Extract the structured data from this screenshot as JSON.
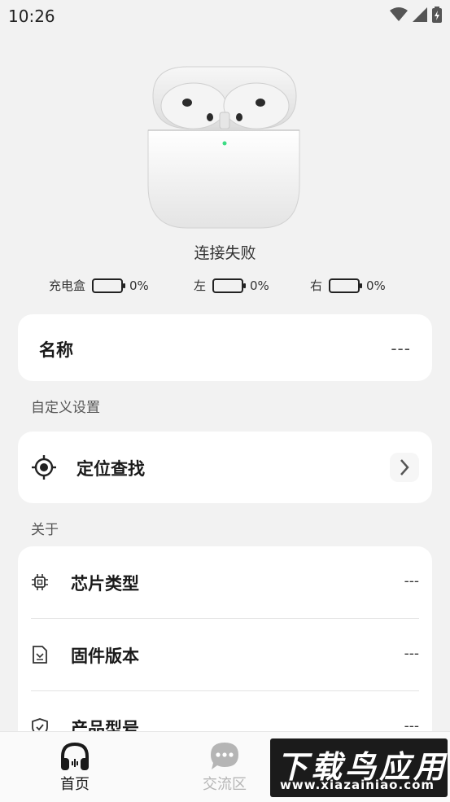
{
  "status_bar": {
    "time": "10:26",
    "icons": [
      "wifi-icon",
      "signal-icon",
      "battery-charging-icon"
    ]
  },
  "device": {
    "image": "airpods-case-illustration",
    "connection_status": "连接失败"
  },
  "battery": [
    {
      "label": "充电盒",
      "percent": "0%"
    },
    {
      "label": "左",
      "percent": "0%"
    },
    {
      "label": "右",
      "percent": "0%"
    }
  ],
  "name_card": {
    "label": "名称",
    "value": "---"
  },
  "custom_settings": {
    "section_title": "自定义设置",
    "locate": {
      "label": "定位查找",
      "icon": "crosshair-icon"
    }
  },
  "about": {
    "section_title": "关于",
    "rows": [
      {
        "label": "芯片类型",
        "value": "---",
        "icon": "chip-icon"
      },
      {
        "label": "固件版本",
        "value": "---",
        "icon": "firmware-doc-icon"
      },
      {
        "label": "产品型号",
        "value": "---",
        "icon": "shield-check-icon"
      }
    ]
  },
  "bottom_nav": [
    {
      "label": "首页",
      "icon": "headphones-icon",
      "active": true
    },
    {
      "label": "交流区",
      "icon": "chat-bubble-icon",
      "active": false
    }
  ],
  "watermark": {
    "title": "下载鸟应用",
    "url": "www.xiazainiao.com"
  },
  "colors": {
    "background": "#f2f2f2",
    "card": "#ffffff",
    "active_nav": "#1a1a1a",
    "inactive_nav": "#b5b5b5",
    "led": "#3ddc84"
  }
}
